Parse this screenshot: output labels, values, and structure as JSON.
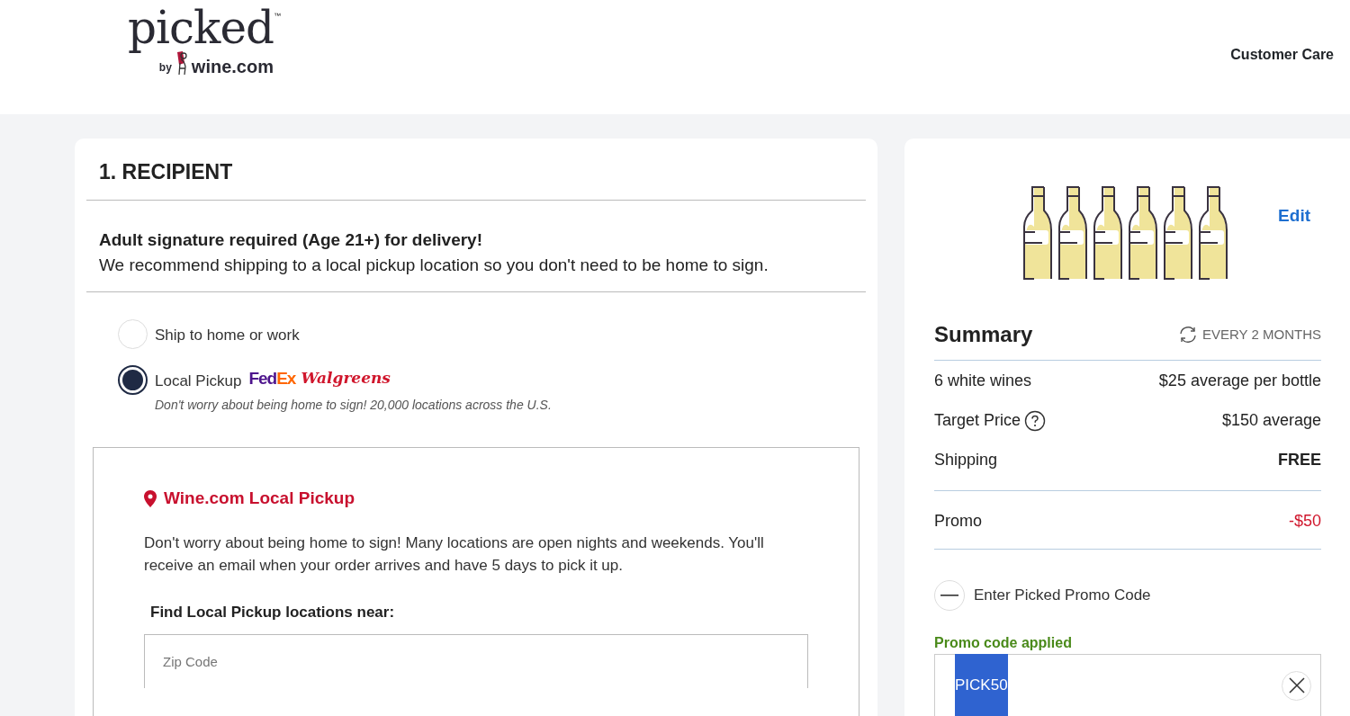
{
  "header": {
    "logo": {
      "wordmark": "picked",
      "trademark": "™",
      "by": "by",
      "brand": "wine.com"
    },
    "links": [
      "Customer Care"
    ]
  },
  "recipient": {
    "title": "1. RECIPIENT",
    "notice": {
      "heading": "Adult signature required (Age 21+) for delivery!",
      "text": "We recommend shipping to a local pickup location so you don't need to be home to sign."
    },
    "options": [
      {
        "label": "Ship to home or work",
        "selected": false
      },
      {
        "label": "Local Pickup",
        "selected": true,
        "carriers": [
          {
            "kind": "fedex",
            "parts": [
              "Fed",
              "Ex"
            ]
          },
          {
            "kind": "walgreens",
            "parts": [
              "Walgreens"
            ]
          }
        ],
        "note": "Don't worry about being home to sign! 20,000 locations across the U.S."
      }
    ],
    "pickup": {
      "title": "Wine.com Local Pickup",
      "text": "Don't worry about being home to sign! Many locations are open nights and weekends. You'll receive an email when your order arrives and have 5 days to pick it up.",
      "search_label": "Find Local Pickup locations near:",
      "zip": {
        "placeholder": "Zip Code"
      }
    }
  },
  "summary": {
    "edit": "Edit",
    "title": "Summary",
    "frequency": "EVERY 2 MONTHS",
    "rows": [
      {
        "label": "6 white wines",
        "value": "$25 average per bottle",
        "kind": "plain"
      },
      {
        "label": "Target Price",
        "value": "$150 average",
        "kind": "help"
      },
      {
        "label": "Shipping",
        "value": "FREE",
        "kind": "bold"
      },
      {
        "label": "Promo",
        "value": "-$50",
        "kind": "discount"
      }
    ],
    "promo": {
      "toggle": "Enter Picked Promo Code",
      "expanded": true,
      "status": "Promo code applied",
      "code": "PICK50",
      "code_selected": true
    }
  }
}
